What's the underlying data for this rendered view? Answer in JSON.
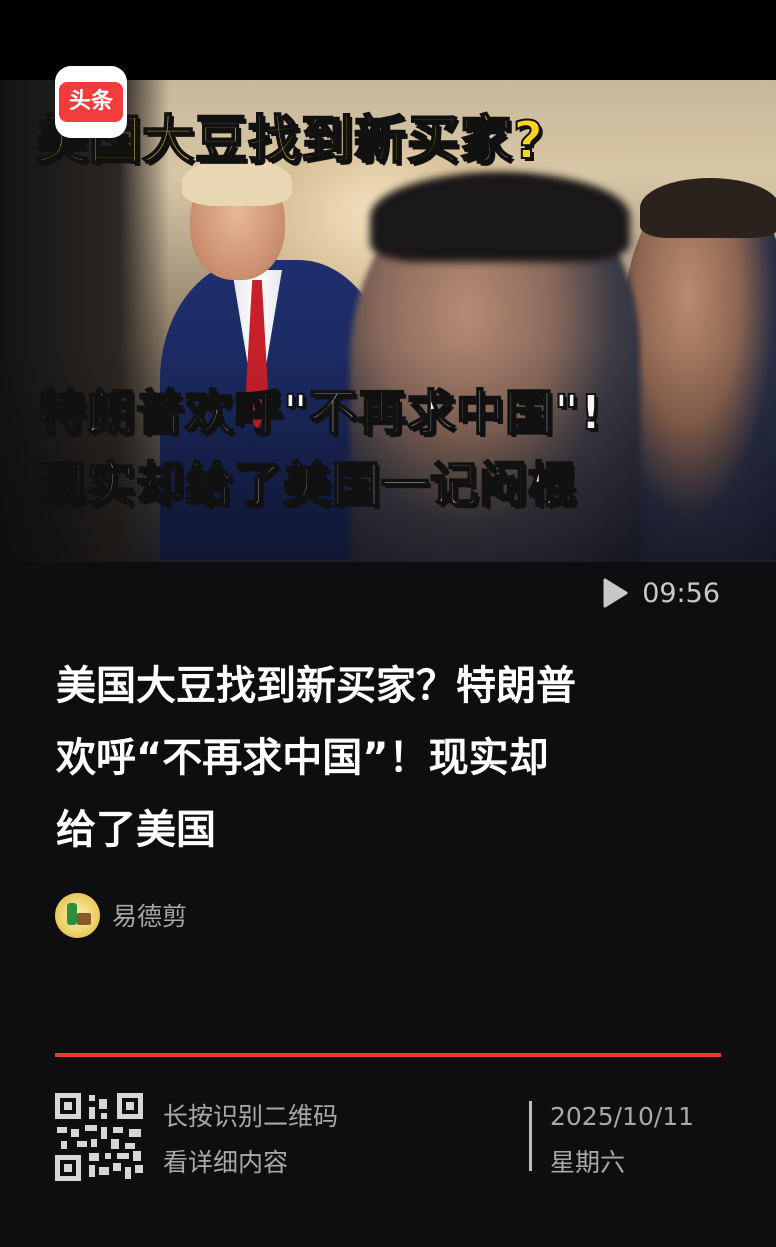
{
  "badge": {
    "label": "头条"
  },
  "thumbnail": {
    "headline_overlay": "美国大豆找到新买家?",
    "subtitle_line1": "特朗普欢呼\"不再求中国\"!",
    "subtitle_line2": "现实却给了美国一记闷棍"
  },
  "video": {
    "duration": "09:56",
    "icon": "play-icon"
  },
  "article": {
    "title_line1": "美国大豆找到新买家？特朗普",
    "title_line2": "欢呼“不再求中国”！现实却",
    "title_line3": "给了美国"
  },
  "author": {
    "name": "易德剪"
  },
  "footer": {
    "qr_hint_line1": "长按识别二维码",
    "qr_hint_line2": "看详细内容",
    "date": "2025/10/11",
    "weekday": "星期六"
  },
  "colors": {
    "background": "#0e0e10",
    "accent_red": "#e43d3a",
    "badge_red": "#f23c3c",
    "overlay_yellow": "#ffd321"
  }
}
